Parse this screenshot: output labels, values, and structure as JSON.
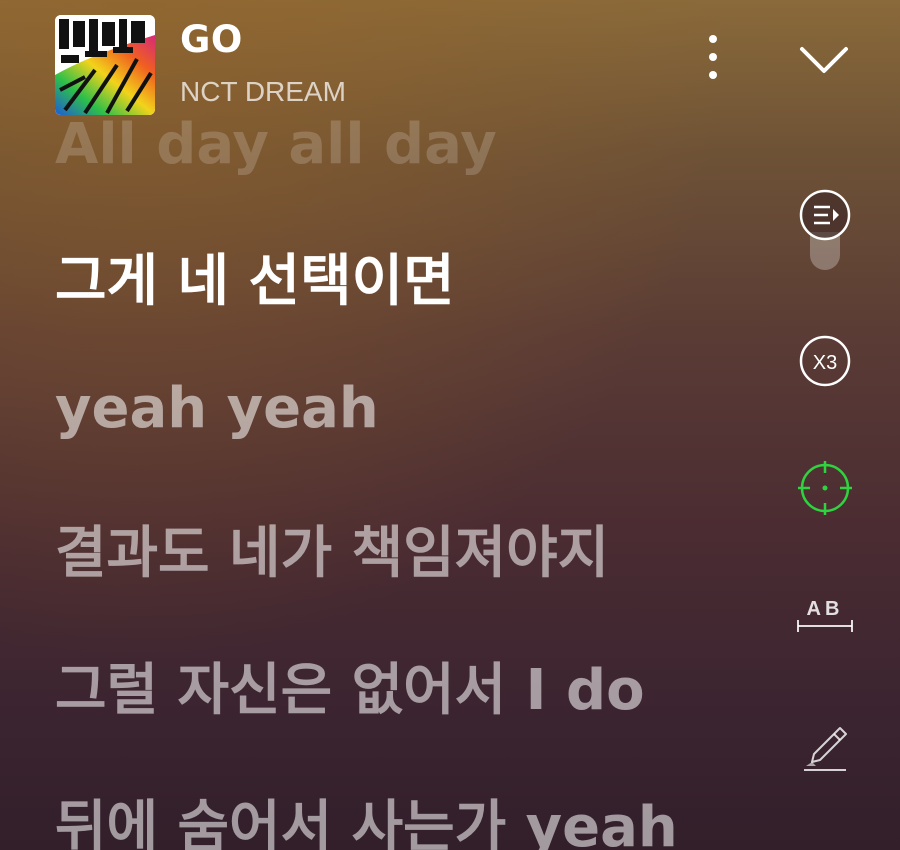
{
  "track": {
    "title": "GO",
    "artist": "NCT DREAM"
  },
  "header": {
    "more_icon": "more-vertical-icon",
    "collapse_icon": "chevron-down-icon"
  },
  "lyrics": [
    {
      "text": "All day all day",
      "state": "past"
    },
    {
      "text": "그게 네 선택이면",
      "state": "current"
    },
    {
      "text": "yeah yeah",
      "state": "upcoming"
    },
    {
      "text": "결과도 네가 책임져야지",
      "state": "upcoming"
    },
    {
      "text": "그럴 자신은 없어서 I do",
      "state": "upcoming"
    },
    {
      "text": "뒤에 숨어서 사는가 yeah",
      "state": "upcoming"
    }
  ],
  "controls": {
    "lyrics_view_icon": "lyrics-list-icon",
    "speed_label": "X3",
    "focus_icon": "crosshair-icon",
    "focus_color": "#2fd23f",
    "ab_repeat_label": "AB",
    "highlight_icon": "highlighter-icon"
  }
}
